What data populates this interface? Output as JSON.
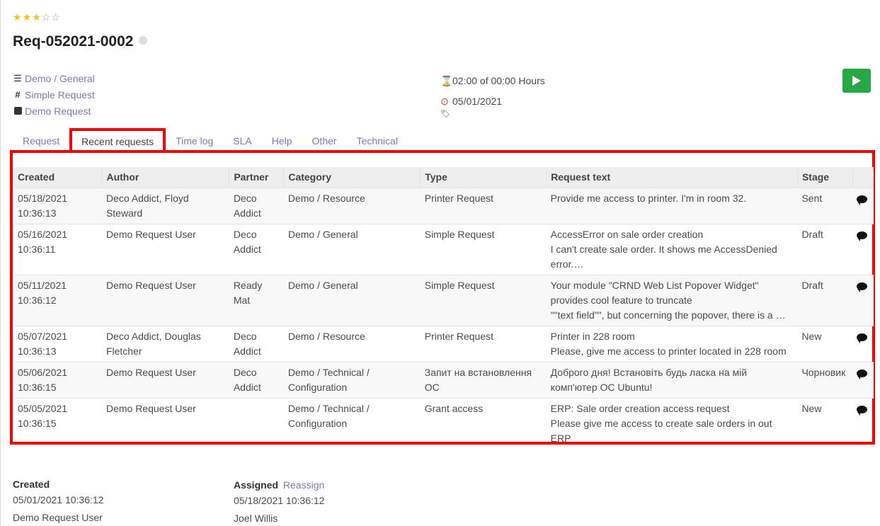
{
  "rating": {
    "value": 3,
    "max": 5
  },
  "request": {
    "name": "Req-052021-0002",
    "category": "Demo / General",
    "type": "Simple Request",
    "service": "Demo Request",
    "time_spent": "02:00 of 00:00 Hours",
    "deadline": "05/01/2021"
  },
  "tabs": [
    {
      "label": "Request"
    },
    {
      "label": "Recent requests"
    },
    {
      "label": "Time log"
    },
    {
      "label": "SLA"
    },
    {
      "label": "Help"
    },
    {
      "label": "Other"
    },
    {
      "label": "Technical"
    }
  ],
  "active_tab": 1,
  "table": {
    "columns": [
      "Created",
      "Author",
      "Partner",
      "Category",
      "Type",
      "Request text",
      "Stage"
    ],
    "rows": [
      {
        "created": [
          "05/18/2021",
          "10:36:13"
        ],
        "author": [
          "Deco Addict, Floyd",
          "Steward"
        ],
        "partner": [
          "Deco",
          "Addict"
        ],
        "category": [
          "Demo / Resource"
        ],
        "type": [
          "Printer Request"
        ],
        "text": [
          "Provide me access to printer. I'm in room 32."
        ],
        "stage": "Sent"
      },
      {
        "created": [
          "05/16/2021",
          "10:36:11"
        ],
        "author": [
          "Demo Request User"
        ],
        "partner": [
          "Deco",
          "Addict"
        ],
        "category": [
          "Demo / General"
        ],
        "type": [
          "Simple Request"
        ],
        "text": [
          "AccessError on sale order creation",
          "I can't create sale order. It shows me AccessDenied",
          "error.…"
        ],
        "stage": "Draft"
      },
      {
        "created": [
          "05/11/2021",
          "10:36:12"
        ],
        "author": [
          "Demo Request User"
        ],
        "partner": [
          "Ready",
          "Mat"
        ],
        "category": [
          "Demo / General"
        ],
        "type": [
          "Simple Request"
        ],
        "text": [
          "Your module \"CRND Web List Popover Widget\"",
          "provides cool feature to truncate",
          "\"\"text field\"\", but concerning the popover, there is a …"
        ],
        "stage": "Draft"
      },
      {
        "created": [
          "05/07/2021",
          "10:36:13"
        ],
        "author": [
          "Deco Addict, Douglas",
          "Fletcher"
        ],
        "partner": [
          "Deco",
          "Addict"
        ],
        "category": [
          "Demo / Resource"
        ],
        "type": [
          "Printer Request"
        ],
        "text": [
          "Printer in 228 room",
          "Please, give me access to printer located in 228 room"
        ],
        "stage": "New"
      },
      {
        "created": [
          "05/06/2021",
          "10:36:15"
        ],
        "author": [
          "Demo Request User"
        ],
        "partner": [
          "Deco",
          "Addict"
        ],
        "category": [
          "Demo / Technical /",
          "Configuration"
        ],
        "type": [
          "Запит на встановлення",
          "ОС"
        ],
        "text": [
          "Доброго дня! Встановіть будь ласка на мій",
          "комп'ютер ОС Ubuntu!"
        ],
        "stage": "Чорновик"
      },
      {
        "created": [
          "05/05/2021",
          "10:36:15"
        ],
        "author": [
          "Demo Request User"
        ],
        "partner": [],
        "category": [
          "Demo / Technical /",
          "Configuration"
        ],
        "type": [
          "Grant access"
        ],
        "text": [
          "ERP: Sale order creation access request",
          "Please give me access to create sale orders in out",
          "ERP"
        ],
        "stage": "New"
      }
    ]
  },
  "footer": {
    "created_label": "Created",
    "created_date": "05/01/2021 10:36:12",
    "created_by": "Demo Request User",
    "assigned_label": "Assigned",
    "reassign_label": "Reassign",
    "assigned_date": "05/18/2021 10:36:12",
    "assigned_to": "Joel Willis"
  },
  "colors": {
    "star": "#f3c318",
    "link": "#7c7bad",
    "highlight": "#ee0000",
    "play": "#28a745"
  },
  "icons": [
    "bars-icon",
    "hashtag-icon",
    "square-icon",
    "hourglass-icon",
    "clock-icon",
    "tags-icon",
    "play-icon",
    "comment-icon"
  ]
}
